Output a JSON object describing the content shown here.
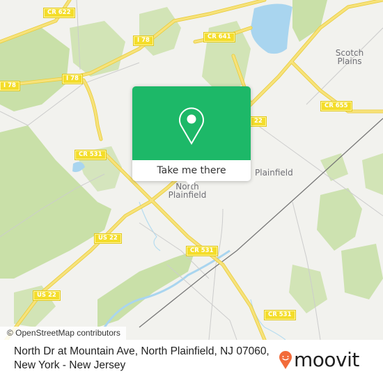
{
  "map": {
    "colors": {
      "background": "#f2f2ee",
      "park": "#c9e0a8",
      "water": "#a9d5ef",
      "road_major": "#f7e27a",
      "road_casing": "#e8cc3a",
      "road_minor": "#c8c8c8",
      "rail": "#777777",
      "shield": "#f4dd2a"
    },
    "road_labels": [
      {
        "id": "cr622",
        "text": "CR 622"
      },
      {
        "id": "i78a",
        "text": "I 78"
      },
      {
        "id": "i78b",
        "text": "I 78"
      },
      {
        "id": "i78c",
        "text": "I 78"
      },
      {
        "id": "cr641",
        "text": "CR 641"
      },
      {
        "id": "cr655",
        "text": "CR 655"
      },
      {
        "id": "us22a",
        "text": "22"
      },
      {
        "id": "cr531a",
        "text": "CR 531"
      },
      {
        "id": "us22b",
        "text": "US 22"
      },
      {
        "id": "us22c",
        "text": "US 22"
      },
      {
        "id": "cr531b",
        "text": "CR 531"
      },
      {
        "id": "cr531c",
        "text": "CR 531"
      }
    ],
    "place_labels": {
      "scotch_plains_1": "Scotch",
      "scotch_plains_2": "Plains",
      "plainfield": "Plainfield",
      "north_plainfield_1": "North",
      "north_plainfield_2": "Plainfield"
    },
    "attribution": "© OpenStreetMap contributors"
  },
  "popup": {
    "icon": "map-pin-icon",
    "button_label": "Take me there",
    "color": "#1db868"
  },
  "footer": {
    "address_line1": "North Dr at Mountain Ave, North Plainfield, NJ 07060,",
    "address_line2": "New York - New Jersey",
    "brand": "moovit",
    "brand_icon": "moovit-pin-smile-icon",
    "brand_color": "#f26b3a"
  }
}
